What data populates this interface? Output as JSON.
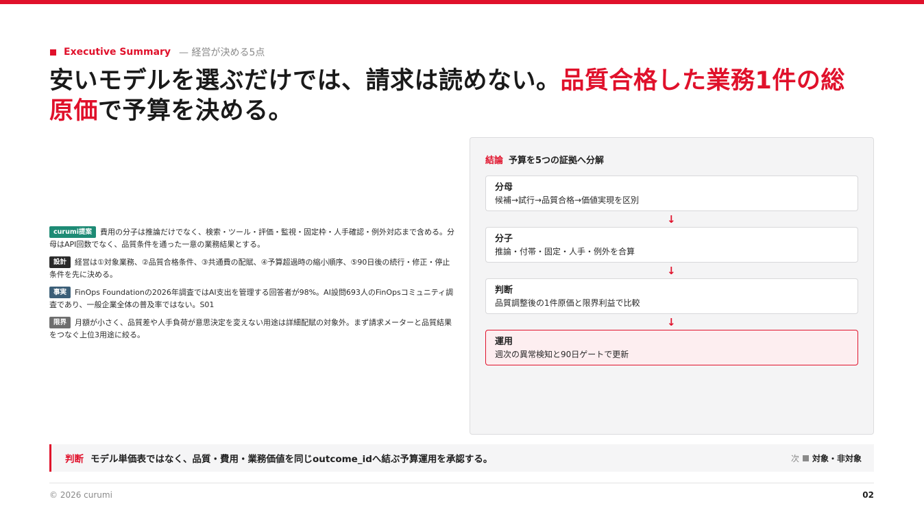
{
  "colors": {
    "accent": "#e0112b",
    "panel_bg": "#f4f4f5",
    "hot_bg": "#fdeef0"
  },
  "kicker": {
    "title": "Executive Summary",
    "subtitle": "— 経営が決める5点"
  },
  "headline": {
    "part1": "安いモデルを選ぶだけでは、請求は読めない。",
    "highlight": "品質合格した業務1件の総原価",
    "part2": "で予算を決める。"
  },
  "notes": [
    {
      "tag": "curumi提案",
      "text": "費用の分子は推論だけでなく、検索・ツール・評価・監視・固定枠・人手確認・例外対応まで含める。分母はAPI回数でなく、品質条件を通った一意の業務結果とする。"
    },
    {
      "tag": "設計",
      "text": "経営は①対象業務、②品質合格条件、③共通費の配賦、④予算超過時の縮小順序、⑤90日後の続行・修正・停止条件を先に決める。"
    },
    {
      "tag": "事実",
      "text": "FinOps Foundationの2026年調査ではAI支出を管理する回答者が98%。AI設問693人のFinOpsコミュニティ調査であり、一般企業全体の普及率ではない。S01"
    },
    {
      "tag": "限界",
      "text": "月額が小さく、品質差や人手負荷が意思決定を変えない用途は詳細配賦の対象外。まず請求メーターと品質結果をつなぐ上位3用途に絞る。"
    }
  ],
  "panel": {
    "label": "結論",
    "title": "予算を5つの証拠へ分解",
    "steps": [
      {
        "title": "分母",
        "desc": "候補→試行→品質合格→価値実現を区別"
      },
      {
        "title": "分子",
        "desc": "推論・付帯・固定・人手・例外を合算"
      },
      {
        "title": "判断",
        "desc": "品質調整後の1件原価と限界利益で比較"
      },
      {
        "title": "運用",
        "desc": "週次の異常検知と90日ゲートで更新"
      }
    ],
    "arrow": "↓"
  },
  "verdict": {
    "label": "判断",
    "text": "モデル単価表ではなく、品質・費用・業務価値を同じoutcome_idへ結ぶ予算運用を承認する。",
    "next_prefix": "次",
    "next_title": "対象・非対象"
  },
  "footer": {
    "copyright": "© 2026 curumi",
    "page": "02"
  }
}
